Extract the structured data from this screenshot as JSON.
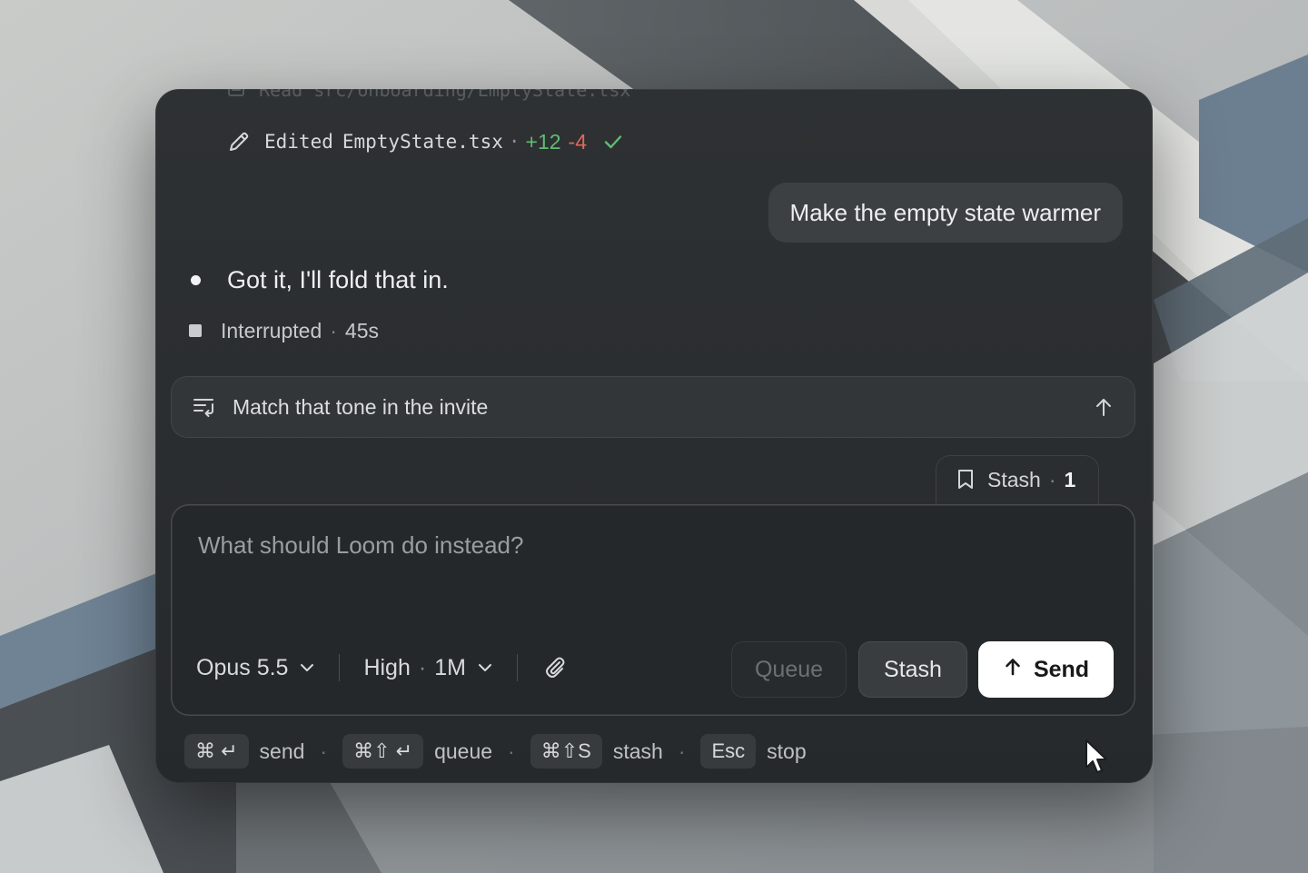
{
  "transcript": {
    "faded_line": "Read src/onboarding/EmptyState.tsx",
    "edit": {
      "prefix": "Edited",
      "file": "EmptyState.tsx",
      "separator": "·",
      "added": "+12",
      "removed": "-4"
    },
    "user_message": "Make the empty state warmer",
    "assistant_message": "Got it, I'll fold that in.",
    "status": {
      "label": "Interrupted",
      "separator": "·",
      "duration": "45s"
    }
  },
  "queued_message": {
    "text": "Match that tone in the invite"
  },
  "stash_tab": {
    "label": "Stash",
    "separator": "·",
    "count": "1"
  },
  "composer": {
    "placeholder": "What should Loom do instead?",
    "model": "Opus 5.5",
    "effort": "High",
    "separator": "·",
    "context": "1M",
    "buttons": {
      "queue": "Queue",
      "stash": "Stash",
      "send": "Send"
    }
  },
  "shortcuts": [
    {
      "keys": "⌘ ↵",
      "label": "send"
    },
    {
      "keys": "⌘⇧ ↵",
      "label": "queue"
    },
    {
      "keys": "⌘⇧S",
      "label": "stash"
    },
    {
      "keys": "Esc",
      "label": "stop"
    }
  ],
  "shortcut_separator": "·",
  "icons": {
    "edit": "pencil-icon",
    "check": "check-icon",
    "queued": "queue-list-icon",
    "send_up": "arrow-up-icon",
    "stash": "bookmark-icon",
    "attach": "paperclip-icon",
    "chevron": "chevron-down-icon"
  },
  "colors": {
    "added": "#5fbd72",
    "removed": "#e0685c",
    "panel": "#2c2f32",
    "send_button": "#ffffff"
  }
}
